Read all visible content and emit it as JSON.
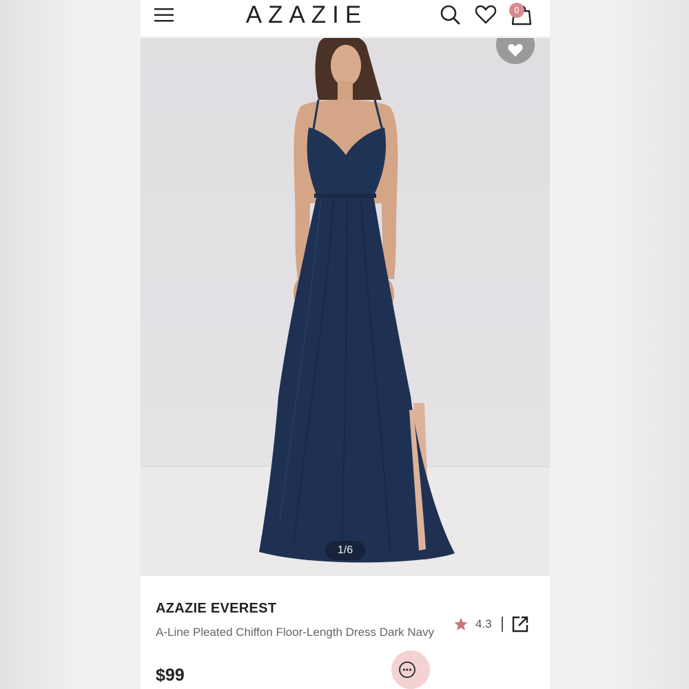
{
  "header": {
    "brand": "AZAZIE",
    "cart_count": "0"
  },
  "gallery": {
    "counter": "1/6"
  },
  "product": {
    "brand": "AZAZIE EVEREST",
    "name": "A-Line Pleated Chiffon Floor-Length Dress Dark Navy",
    "price": "$99",
    "rating": "4.3"
  },
  "colors": {
    "accent": "#d98a8e",
    "dress": "#1f3354"
  },
  "icons": [
    "menu-icon",
    "search-icon",
    "heart-icon",
    "bag-icon",
    "favorite-icon",
    "star-icon",
    "share-icon",
    "chat-icon"
  ]
}
